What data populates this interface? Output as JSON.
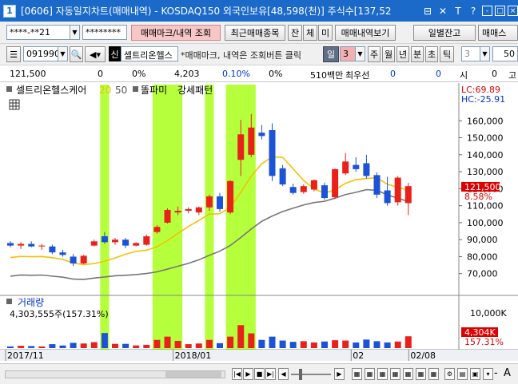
{
  "window": {
    "screen_no": "1",
    "title": "[0606] 자동일지차트(매매내역) - KOSDAQ150 외국인보유[48,598(천)] 주식수[137,52",
    "controls": [
      "⊟",
      "✕",
      "T",
      "?",
      "-",
      "□",
      "×"
    ]
  },
  "toolbar1": {
    "account": "****-**21",
    "password": "********",
    "trade_mark_btn": "매매마크/내역 조회",
    "recent_trades_btn": "최근매매종목",
    "tab_jan": "잔",
    "tab_che": "체",
    "tab_mi": "미",
    "trade_history_btn": "매매내역보기",
    "daily_balance_btn": "일별잔고",
    "trade_right_btn": "매매스"
  },
  "toolbar2": {
    "stock_code": "091990",
    "sin_badge": "신",
    "stock_name": "셀트리온헬스",
    "hint": "*매매마크, 내역은 조회버튼 클릭",
    "period_label": "일",
    "period_value": "3",
    "periods": [
      "주",
      "월",
      "년",
      "분",
      "초",
      "틱"
    ],
    "tick_value": "3",
    "right_value": "50"
  },
  "pricebar": {
    "price": "121,500",
    "change": "0",
    "change_pct": "0%",
    "volume": "4,203",
    "ratio": "0.10%",
    "pct2": "0%",
    "amount": "510백만",
    "best_ask_label": "최우선",
    "v1": "0",
    "v2": "0",
    "open_label": "시",
    "open_val": "0",
    "high_label": "고"
  },
  "chart_data": {
    "type": "candlestick",
    "price_legend": {
      "stock": "셀트리온헬스케어",
      "ma": "20",
      "ma2": "50",
      "pattern1": "똘파미",
      "pattern2": "강세패턴"
    },
    "lc_label": "LC:69.89",
    "hc_label": "HC:-25.91",
    "price_ticks": [
      "160,000",
      "150,000",
      "140,000",
      "130,000",
      "120,000",
      "110,000",
      "100,000",
      "90,000",
      "80,000",
      "70,000"
    ],
    "price_tick_values": [
      160000,
      150000,
      140000,
      130000,
      120000,
      110000,
      100000,
      90000,
      80000,
      70000
    ],
    "ylim": [
      60000,
      170000
    ],
    "current_price_label": "121,500",
    "current_pct_label": "8.58%",
    "volume_legend": "거래량",
    "volume_summary": "4,303,555주(157.31%)",
    "volume_tick": "10,000K",
    "volume_current_label": "4,304K",
    "volume_pct_label": "157.31%",
    "x_labels": [
      "2017/11",
      "2018/01",
      "02",
      "02/08"
    ],
    "x_label_idx": [
      0,
      16,
      33,
      38.5
    ],
    "highlight_ranges": [
      [
        9,
        9
      ],
      [
        14,
        16
      ],
      [
        19,
        19
      ],
      [
        21,
        23
      ]
    ],
    "candles": [
      {
        "o": 88000,
        "h": 89000,
        "l": 85500,
        "c": 86500,
        "v": 500
      },
      {
        "o": 86500,
        "h": 88500,
        "l": 84500,
        "c": 87500,
        "v": 700
      },
      {
        "o": 87500,
        "h": 89000,
        "l": 85500,
        "c": 86000,
        "v": 600
      },
      {
        "o": 86000,
        "h": 87500,
        "l": 84000,
        "c": 86500,
        "v": 500
      },
      {
        "o": 86000,
        "h": 87000,
        "l": 81500,
        "c": 82500,
        "v": 1200
      },
      {
        "o": 82500,
        "h": 84000,
        "l": 80000,
        "c": 81000,
        "v": 800
      },
      {
        "o": 80000,
        "h": 81500,
        "l": 74500,
        "c": 76000,
        "v": 1600
      },
      {
        "o": 76000,
        "h": 81000,
        "l": 75500,
        "c": 80500,
        "v": 1400
      },
      {
        "o": 86500,
        "h": 90000,
        "l": 86000,
        "c": 89000,
        "v": 1800
      },
      {
        "o": 92000,
        "h": 94500,
        "l": 87500,
        "c": 88500,
        "v": 4600
      },
      {
        "o": 88500,
        "h": 91000,
        "l": 87000,
        "c": 90000,
        "v": 1300
      },
      {
        "o": 90000,
        "h": 91000,
        "l": 85000,
        "c": 86500,
        "v": 1300
      },
      {
        "o": 86500,
        "h": 88500,
        "l": 86000,
        "c": 88000,
        "v": 800
      },
      {
        "o": 87000,
        "h": 93000,
        "l": 86500,
        "c": 92000,
        "v": 1000
      },
      {
        "o": 94500,
        "h": 98500,
        "l": 93500,
        "c": 97500,
        "v": 2500
      },
      {
        "o": 100000,
        "h": 108500,
        "l": 99500,
        "c": 107500,
        "v": 3500
      },
      {
        "o": 106000,
        "h": 109500,
        "l": 104500,
        "c": 107000,
        "v": 2200
      },
      {
        "o": 107000,
        "h": 109000,
        "l": 105500,
        "c": 108000,
        "v": 1200
      },
      {
        "o": 106000,
        "h": 109500,
        "l": 104500,
        "c": 109000,
        "v": 1400
      },
      {
        "o": 109000,
        "h": 116500,
        "l": 107000,
        "c": 115500,
        "v": 2500
      },
      {
        "o": 115500,
        "h": 117500,
        "l": 106500,
        "c": 108000,
        "v": 1500
      },
      {
        "o": 106000,
        "h": 125000,
        "l": 105000,
        "c": 124500,
        "v": 3500
      },
      {
        "o": 137000,
        "h": 160500,
        "l": 127500,
        "c": 152000,
        "v": 7000
      },
      {
        "o": 140000,
        "h": 164000,
        "l": 138500,
        "c": 156000,
        "v": 4500
      },
      {
        "o": 153000,
        "h": 157500,
        "l": 149000,
        "c": 151000,
        "v": 2500
      },
      {
        "o": 154500,
        "h": 158500,
        "l": 124500,
        "c": 127500,
        "v": 3500
      },
      {
        "o": 132000,
        "h": 134000,
        "l": 121500,
        "c": 122500,
        "v": 2300
      },
      {
        "o": 121000,
        "h": 123000,
        "l": 116500,
        "c": 117500,
        "v": 1900
      },
      {
        "o": 118000,
        "h": 122500,
        "l": 117000,
        "c": 121500,
        "v": 2100
      },
      {
        "o": 119500,
        "h": 125500,
        "l": 118500,
        "c": 125000,
        "v": 1700
      },
      {
        "o": 122000,
        "h": 123500,
        "l": 113500,
        "c": 114500,
        "v": 2000
      },
      {
        "o": 115000,
        "h": 132000,
        "l": 114000,
        "c": 131500,
        "v": 2400
      },
      {
        "o": 129000,
        "h": 141000,
        "l": 128000,
        "c": 136000,
        "v": 2300
      },
      {
        "o": 134000,
        "h": 138500,
        "l": 130000,
        "c": 131500,
        "v": 1700
      },
      {
        "o": 135000,
        "h": 140000,
        "l": 126000,
        "c": 127500,
        "v": 2600
      },
      {
        "o": 128000,
        "h": 129500,
        "l": 114500,
        "c": 116500,
        "v": 2100
      },
      {
        "o": 119000,
        "h": 127000,
        "l": 110000,
        "c": 111500,
        "v": 1700
      },
      {
        "o": 112000,
        "h": 127500,
        "l": 110000,
        "c": 126500,
        "v": 2000
      },
      {
        "o": 111500,
        "h": 123500,
        "l": 104500,
        "c": 121500,
        "v": 3600
      }
    ]
  }
}
